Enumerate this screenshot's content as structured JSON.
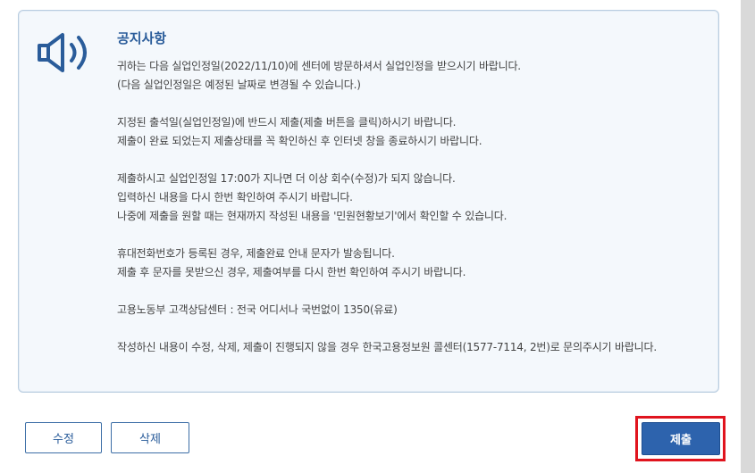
{
  "notice": {
    "title": "공지사항",
    "icon": "speaker-icon",
    "paragraphs": [
      {
        "lines": [
          "귀하는 다음 실업인정일(2022/11/10)에 센터에 방문하셔서 실업인정을 받으시기 바랍니다.",
          "(다음 실업인정일은 예정된 날짜로 변경될 수 있습니다.)"
        ]
      },
      {
        "lines": [
          "지정된 출석일(실업인정일)에 반드시 제출(제출 버튼을 클릭)하시기 바랍니다.",
          "제출이 완료 되었는지 제출상태를 꼭 확인하신 후 인터넷 창을 종료하시기 바랍니다."
        ]
      },
      {
        "lines": [
          "제출하시고 실업인정일 17:00가 지나면 더 이상 회수(수정)가 되지 않습니다.",
          "입력하신 내용을 다시 한번 확인하여 주시기 바랍니다.",
          "나중에 제출을 원할 때는 현재까지 작성된 내용을 '민원현황보기'에서 확인할 수 있습니다."
        ]
      },
      {
        "lines": [
          "휴대전화번호가 등록된 경우, 제출완료 안내 문자가 발송됩니다.",
          "제출 후 문자를 못받으신 경우, 제출여부를 다시 한번 확인하여 주시기 바랍니다."
        ]
      },
      {
        "lines": [
          "고용노동부 고객상담센터 : 전국 어디서나 국번없이 1350(유료)"
        ]
      },
      {
        "lines": [
          "작성하신 내용이 수정, 삭제, 제출이 진행되지 않을 경우 한국고용정보원 콜센터(1577-7114, 2번)로 문의주시기 바랍니다."
        ]
      }
    ]
  },
  "buttons": {
    "edit": "수정",
    "delete": "삭제",
    "submit": "제출"
  },
  "colors": {
    "accent": "#2a5c9a",
    "submit_bg": "#2d63ad",
    "highlight": "#e0141e",
    "notice_bg": "#f4f8fc"
  }
}
